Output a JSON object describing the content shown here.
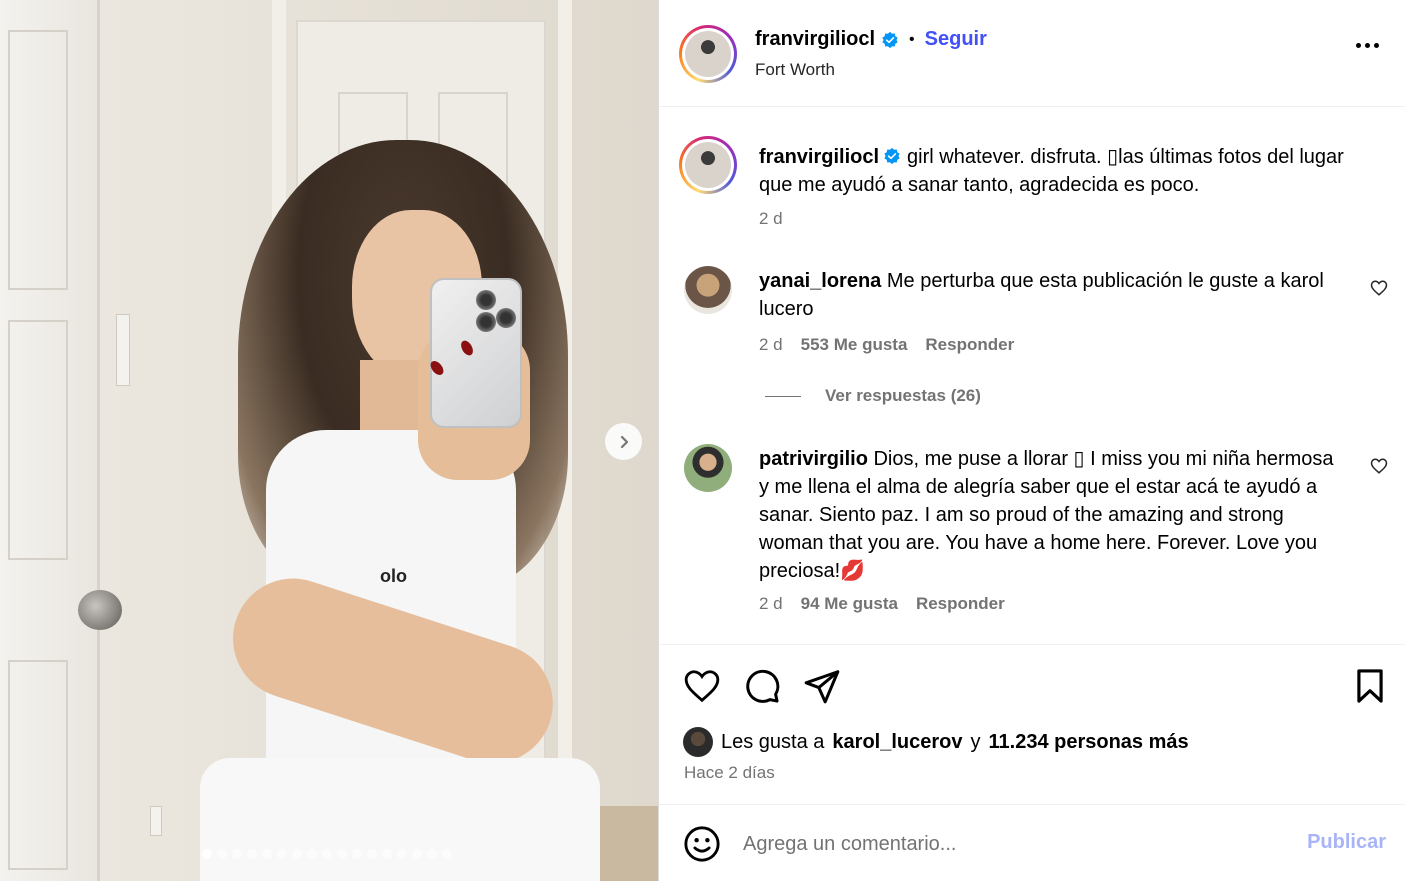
{
  "post": {
    "photo_alt": "Mirror selfie",
    "carousel_total": 17,
    "carousel_active": 1
  },
  "header": {
    "username": "franvirgiliocl",
    "separator": "•",
    "follow_label": "Seguir",
    "location": "Fort Worth"
  },
  "caption": {
    "username": "franvirgiliocl",
    "text": "girl whatever. disfruta. ▯​las últimas fotos del lugar que me ayudó a sanar tanto, agradecida es poco.",
    "time": "2 d"
  },
  "comments": [
    {
      "username": "yanai_lorena",
      "text": "Me perturba que esta publicación le guste a karol lucero",
      "time": "2 d",
      "likes": "553 Me gusta",
      "reply_label": "Responder",
      "view_replies": "Ver respuestas (26)"
    },
    {
      "username": "patrivirgilio",
      "text": "Dios, me puse a llorar ▯ I miss you mi niña hermosa y me llena el alma de alegría saber que el estar acá te ayudó a sanar. Siento paz. I am so proud of the amazing and strong woman that you are. You have a home here. Forever. Love you preciosa!💋",
      "time": "2 d",
      "likes": "94 Me gusta",
      "reply_label": "Responder"
    }
  ],
  "actions": {
    "likes_prefix": "Les gusta a",
    "likes_user": "karol_lucerov",
    "likes_middle": "y",
    "likes_count": "11.234 personas más",
    "posted_ago": "Hace 2 días"
  },
  "composer": {
    "placeholder": "Agrega un comentario...",
    "publish_label": "Publicar"
  },
  "colors": {
    "accent": "#4150f7",
    "muted": "#737373",
    "publish_disabled": "#a8b4f8",
    "verified": "#0095f6"
  },
  "icons": [
    "chevron-right-icon",
    "more-icon",
    "verified-icon",
    "heart-icon",
    "comment-icon",
    "share-icon",
    "bookmark-icon",
    "emoji-icon"
  ]
}
